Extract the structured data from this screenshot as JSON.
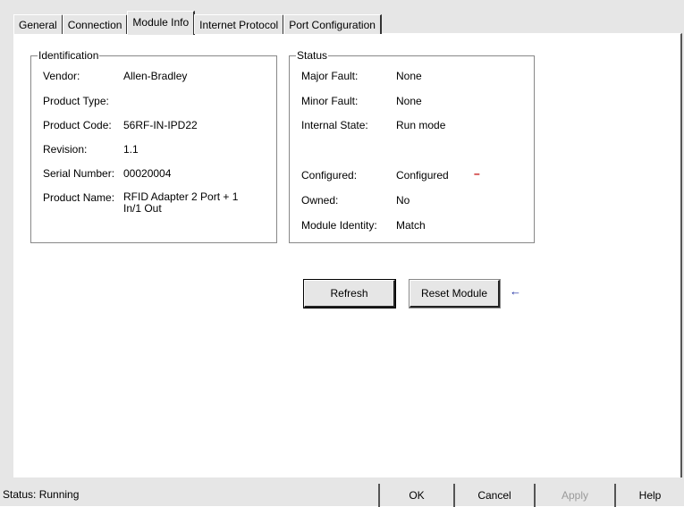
{
  "tabs": [
    {
      "label": "General"
    },
    {
      "label": "Connection"
    },
    {
      "label": "Module Info"
    },
    {
      "label": "Internet Protocol"
    },
    {
      "label": "Port Configuration"
    }
  ],
  "identification": {
    "title": "Identification",
    "rows": [
      {
        "label": "Vendor:",
        "value": "Allen-Bradley"
      },
      {
        "label": "Product Type:",
        "value": ""
      },
      {
        "label": "Product Code:",
        "value": "56RF-IN-IPD22"
      },
      {
        "label": "Revision:",
        "value": "1.1"
      },
      {
        "label": "Serial Number:",
        "value": "00020004"
      },
      {
        "label": "Product Name:",
        "value": "RFID Adapter 2 Port + 1\nIn/1 Out"
      }
    ]
  },
  "status_group": {
    "title": "Status",
    "rows": [
      {
        "label": "Major Fault:",
        "value": "None"
      },
      {
        "label": "Minor Fault:",
        "value": "None"
      },
      {
        "label": "Internal State:",
        "value": "Run mode"
      },
      {
        "label": "Configured:",
        "value": "Configured"
      },
      {
        "label": "Owned:",
        "value": "No"
      },
      {
        "label": "Module Identity:",
        "value": "Match"
      }
    ],
    "configured_marker": "–"
  },
  "buttons": {
    "refresh": "Refresh",
    "reset": "Reset Module",
    "reset_arrow": "←"
  },
  "statusbar": {
    "status": "Status:  Running",
    "ok": "OK",
    "cancel": "Cancel",
    "apply": "Apply",
    "help": "Help"
  }
}
